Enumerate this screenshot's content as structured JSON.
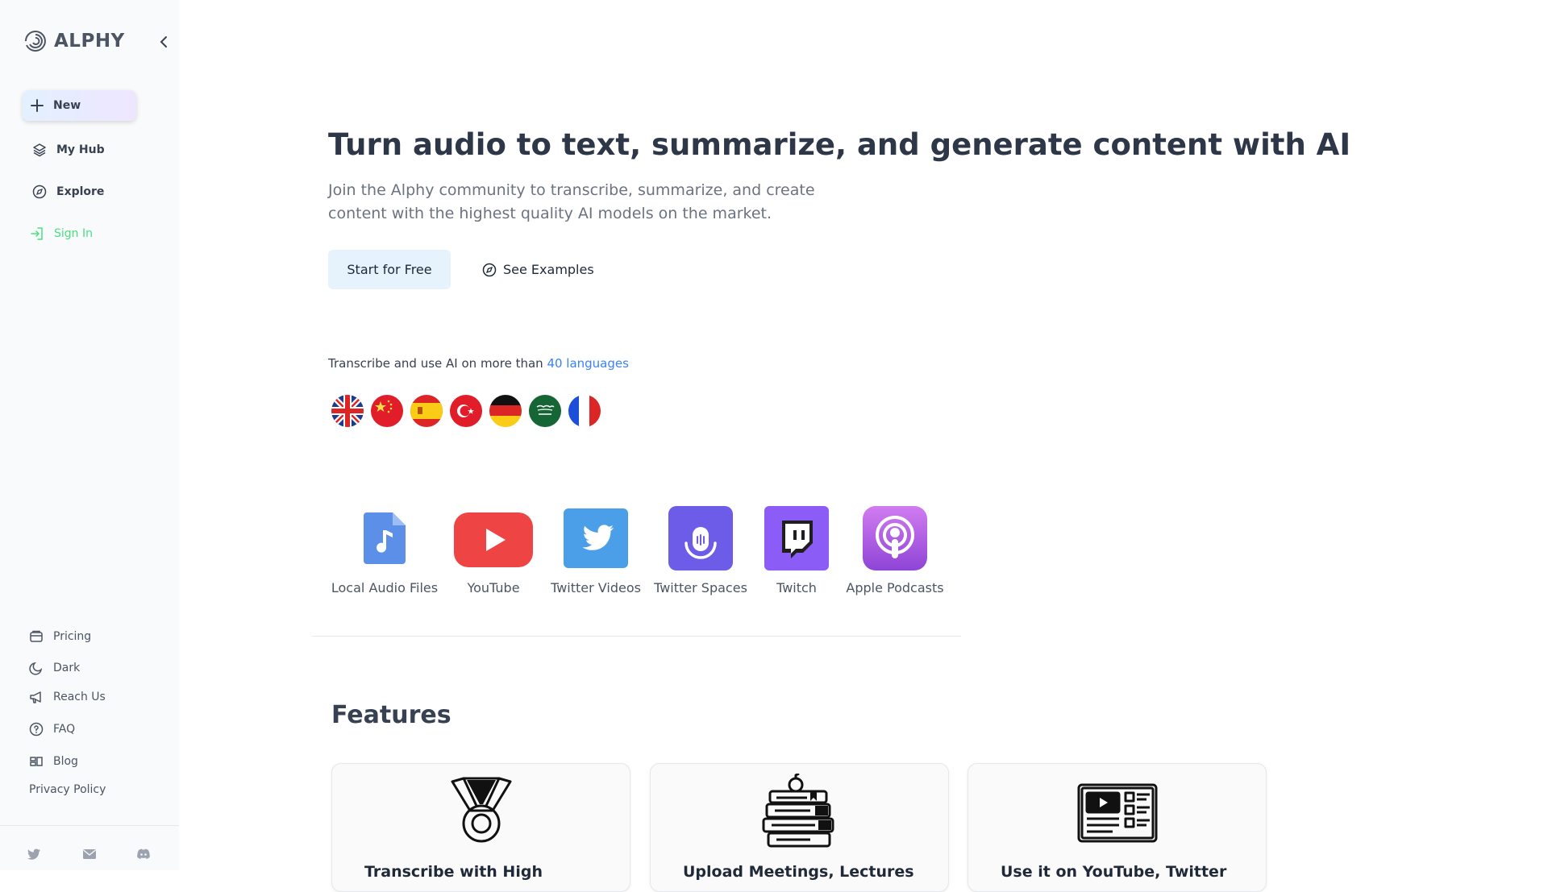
{
  "brand": {
    "name": "ALPHY"
  },
  "sidebar": {
    "new_label": "New",
    "items": [
      {
        "label": "My Hub",
        "icon": "layers-icon"
      },
      {
        "label": "Explore",
        "icon": "compass-icon"
      },
      {
        "label": "Sign In",
        "icon": "sign-in-icon"
      }
    ],
    "bottom": [
      {
        "label": "Pricing",
        "icon": "wallet-icon"
      },
      {
        "label": "Dark",
        "icon": "moon-icon"
      },
      {
        "label": "Reach Us",
        "icon": "megaphone-icon"
      },
      {
        "label": "FAQ",
        "icon": "question-icon"
      },
      {
        "label": "Blog",
        "icon": "blog-icon"
      },
      {
        "label": "Privacy Policy"
      }
    ],
    "social": [
      "twitter-icon",
      "mail-icon",
      "discord-icon"
    ]
  },
  "hero": {
    "title": "Turn audio to text, summarize, and generate content with AI",
    "subtitle": "Join the Alphy community to transcribe, summarize, and create content with the highest quality AI models on the market.",
    "start_label": "Start for Free",
    "examples_label": "See Examples"
  },
  "languages": {
    "text": "Transcribe and use AI on more than ",
    "link": "40 languages",
    "flags": [
      "uk-flag",
      "china-flag",
      "spain-flag",
      "turkey-flag",
      "germany-flag",
      "saudi-flag",
      "france-flag"
    ]
  },
  "sources": [
    {
      "label": "Local Audio Files",
      "icon": "audio-file-icon"
    },
    {
      "label": "YouTube",
      "icon": "youtube-icon"
    },
    {
      "label": "Twitter Videos",
      "icon": "twitter-icon"
    },
    {
      "label": "Twitter Spaces",
      "icon": "spaces-icon"
    },
    {
      "label": "Twitch",
      "icon": "twitch-icon"
    },
    {
      "label": "Apple Podcasts",
      "icon": "podcasts-icon"
    }
  ],
  "features": {
    "title": "Features",
    "cards": [
      {
        "title": "Transcribe with High",
        "icon": "medal-icon"
      },
      {
        "title": "Upload Meetings, Lectures",
        "icon": "books-icon"
      },
      {
        "title": "Use it on YouTube, Twitter",
        "icon": "video-panel-icon"
      }
    ]
  },
  "colors": {
    "accent": "#3b82f6",
    "signin": "#4ade80",
    "youtube": "#ef4444",
    "twitter": "#4a9fe8",
    "spaces": "#6d5ce8",
    "twitch": "#8b5cf6",
    "podcasts": "#b866e6"
  }
}
